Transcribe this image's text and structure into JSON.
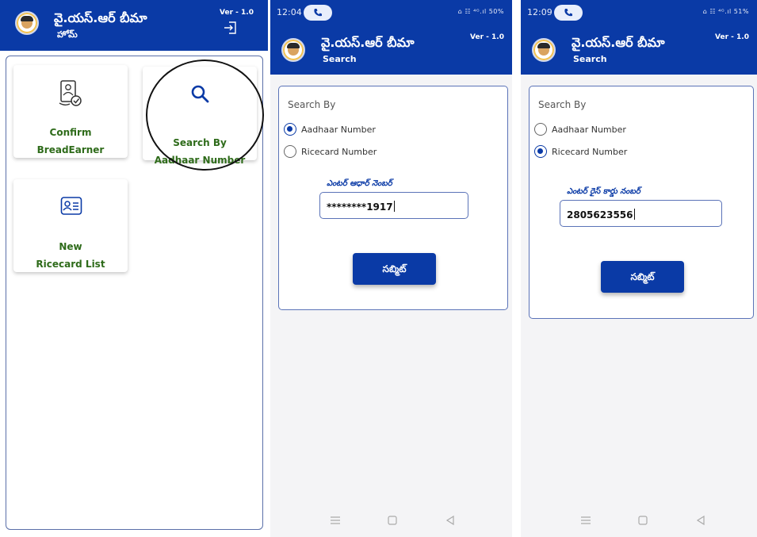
{
  "app": {
    "title": "వై.యస్.ఆర్ బీమా",
    "version": "Ver - 1.0",
    "brand_color": "#0a3aa6",
    "accent_green": "#2e6b1a"
  },
  "home": {
    "subtitle": "హోమ్",
    "tiles": [
      {
        "line1": "Confirm",
        "line2": "BreadEarner",
        "icon": "id-card-verified-icon"
      },
      {
        "line1": "Search By",
        "line2": "Aadhaar Number",
        "icon": "search-icon"
      },
      {
        "line1": "New",
        "line2": "Ricecard List",
        "icon": "contact-card-icon"
      }
    ]
  },
  "search_aadhaar": {
    "status_time": "12:04",
    "status_right": "⌂ ☷ ⁴ᴳ.ıl 50%",
    "subtitle": "Search",
    "search_by_label": "Search By",
    "options": [
      "Aadhaar Number",
      "Ricecard Number"
    ],
    "selected": "Aadhaar Number",
    "field_label": "ఎంటర్ ఆధార్ నెంబర్",
    "field_value": "********1917",
    "submit_label": "సబ్మిట్"
  },
  "search_ricecard": {
    "status_time": "12:09",
    "status_right": "⌂ ☷ ⁴ᴳ.ıl 51%",
    "subtitle": "Search",
    "search_by_label": "Search By",
    "options": [
      "Aadhaar Number",
      "Ricecard Number"
    ],
    "selected": "Ricecard Number",
    "field_label": "ఎంటర్ రైస్ కార్డు నంబర్",
    "field_value": "2805623556",
    "submit_label": "సబ్మిట్"
  }
}
